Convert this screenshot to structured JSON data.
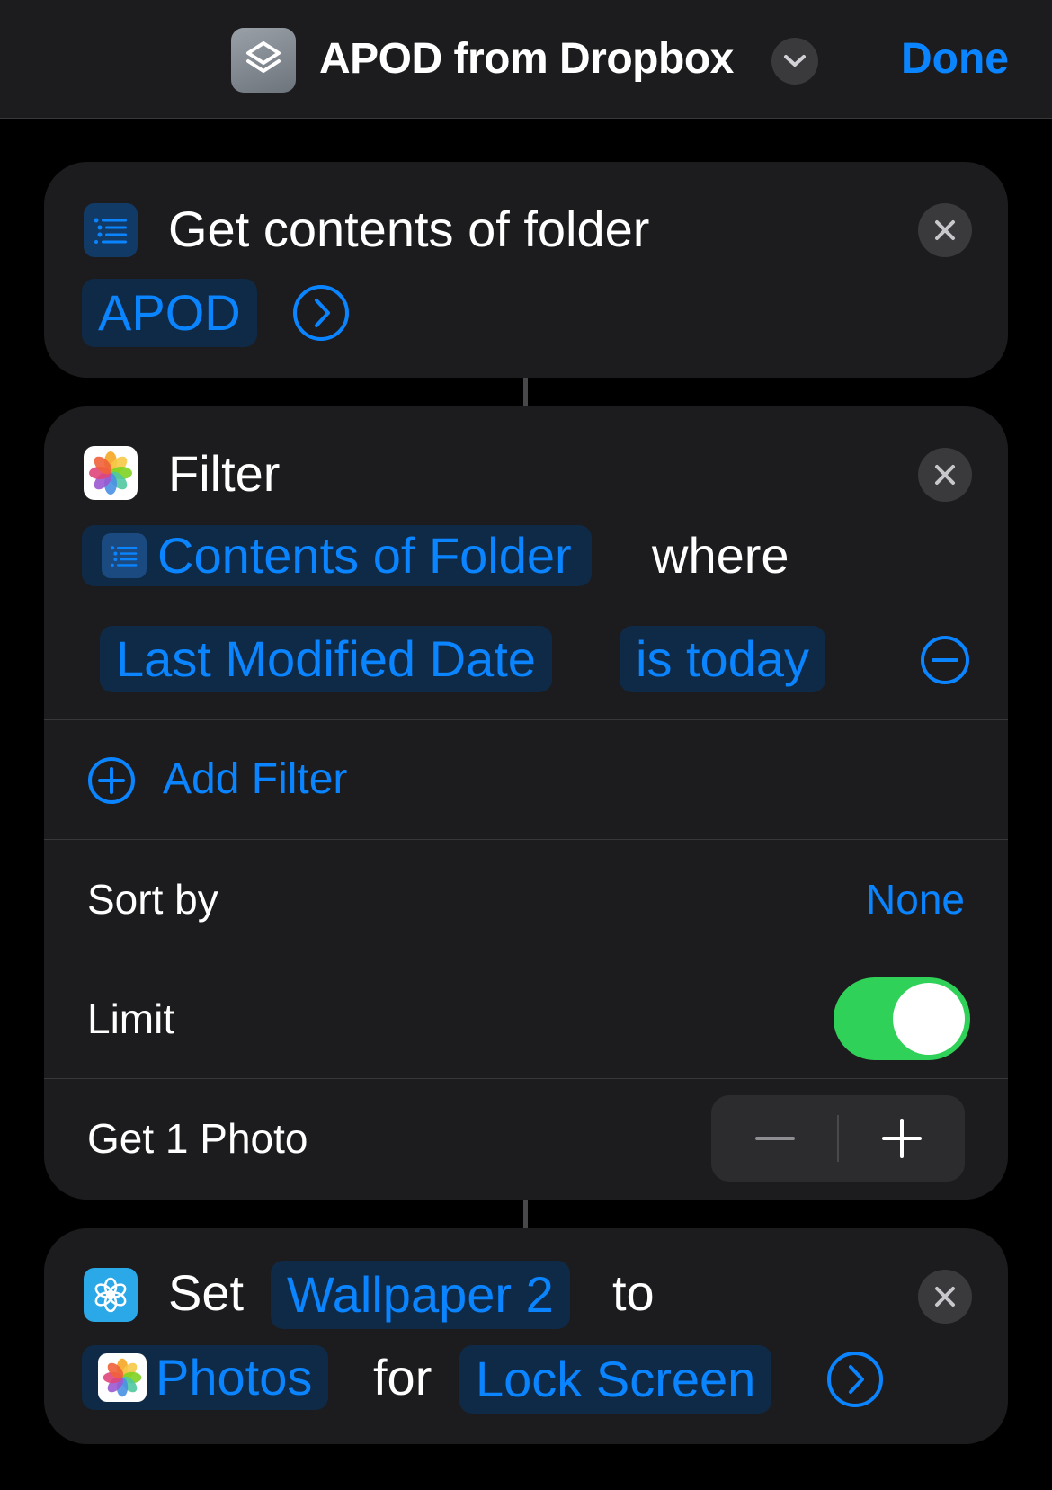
{
  "header": {
    "title": "APOD from Dropbox",
    "done_label": "Done",
    "app_icon": "shortcuts-icon"
  },
  "actions": [
    {
      "title": "Get contents of folder",
      "icon": "list-icon",
      "folder_token": "APOD"
    },
    {
      "title": "Filter",
      "icon": "photos-icon",
      "input_token": "Contents of Folder",
      "where_text": "where",
      "filter": {
        "property": "Last Modified Date",
        "condition": "is today"
      },
      "add_filter_label": "Add Filter",
      "sort_by": {
        "label": "Sort by",
        "value": "None"
      },
      "limit": {
        "label": "Limit",
        "enabled": true
      },
      "get_count": {
        "label": "Get 1 Photo"
      }
    },
    {
      "set_text": "Set",
      "icon": "wallpaper-icon",
      "wallpaper_token": "Wallpaper 2",
      "to_text": "to",
      "photos_token": "Photos",
      "for_text": "for",
      "screen_token": "Lock Screen"
    }
  ],
  "colors": {
    "accent": "#0a84ff",
    "toggle_on": "#30d158",
    "card_bg": "#1c1c1e",
    "token_bg": "#0f2a47"
  }
}
